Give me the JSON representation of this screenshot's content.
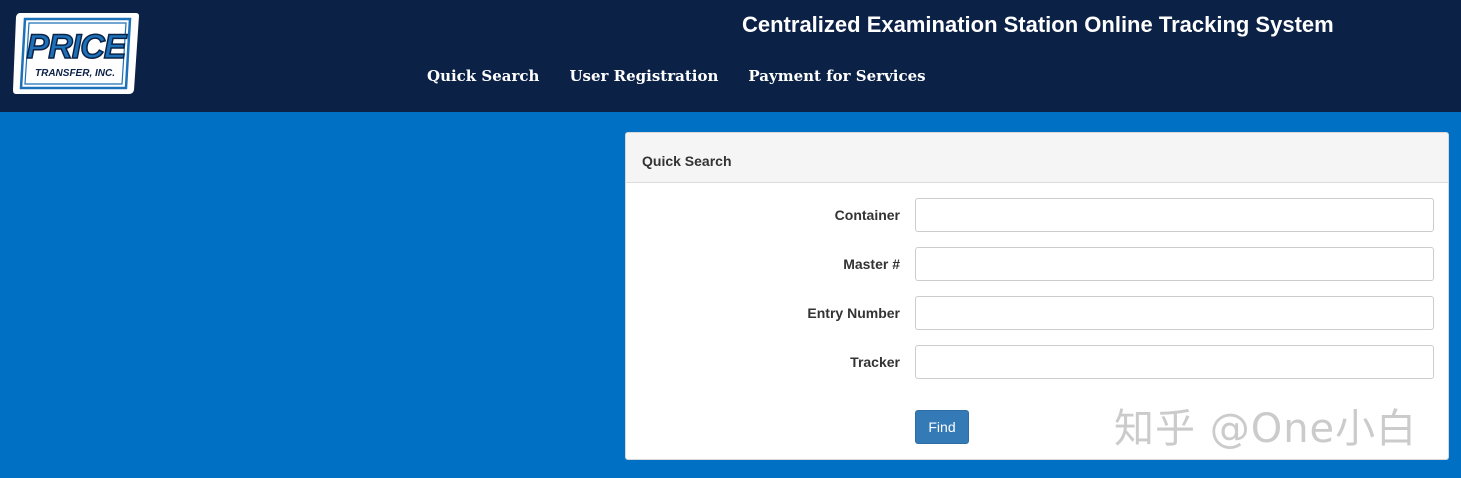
{
  "logo": {
    "brand": "PRICE",
    "subtitle": "TRANSFER, INC."
  },
  "header": {
    "title": "Centralized Examination Station Online Tracking System"
  },
  "nav": {
    "items": [
      {
        "label": "Quick Search"
      },
      {
        "label": "User Registration"
      },
      {
        "label": "Payment for Services"
      }
    ]
  },
  "panel": {
    "heading": "Quick Search",
    "fields": [
      {
        "label": "Container",
        "value": "",
        "placeholder": ""
      },
      {
        "label": "Master #",
        "value": "",
        "placeholder": ""
      },
      {
        "label": "Entry Number",
        "value": "",
        "placeholder": ""
      },
      {
        "label": "Tracker",
        "value": "",
        "placeholder": ""
      }
    ],
    "find_label": "Find"
  },
  "watermark": {
    "text": "知乎 @One小白"
  },
  "colors": {
    "header_bg": "#0b2146",
    "page_bg": "#0070c4",
    "button_bg": "#337ab7"
  }
}
